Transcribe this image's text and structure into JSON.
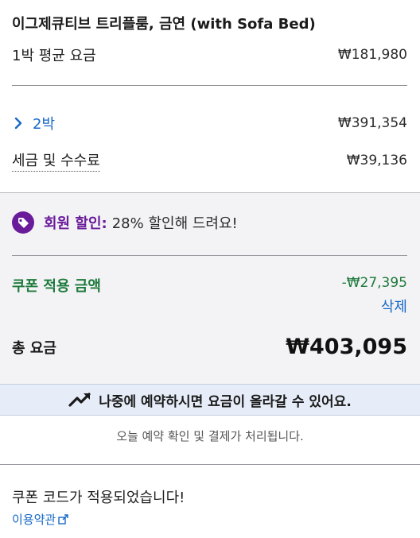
{
  "room": {
    "title": "이그제큐티브 트리플룸, 금연 (with Sofa Bed)"
  },
  "avg_nightly": {
    "label": "1박 평균 요금",
    "price": "₩181,980"
  },
  "nights": {
    "label": "2박",
    "price": "₩391,354"
  },
  "taxes": {
    "label": "세금 및 수수료",
    "price": "₩39,136"
  },
  "member_discount": {
    "label": "회원 할인:",
    "text": "28% 할인해 드려요!"
  },
  "coupon": {
    "label": "쿠폰 적용 금액",
    "amount": "-₩27,395",
    "delete_label": "삭제"
  },
  "total": {
    "label": "총 요금",
    "amount": "₩403,095"
  },
  "alert": {
    "text": "나중에 예약하시면 요금이 올라갈 수 있어요."
  },
  "note": {
    "text": "오늘 예약 확인 및 결제가 처리됩니다."
  },
  "coupon_applied": {
    "text": "쿠폰 코드가 적용되었습니다!"
  },
  "terms": {
    "label": "이용약관"
  },
  "colors": {
    "link": "#1668c7",
    "member": "#6a1b9a",
    "coupon": "#1e7a3c",
    "alert_bg": "#e6edf8"
  }
}
